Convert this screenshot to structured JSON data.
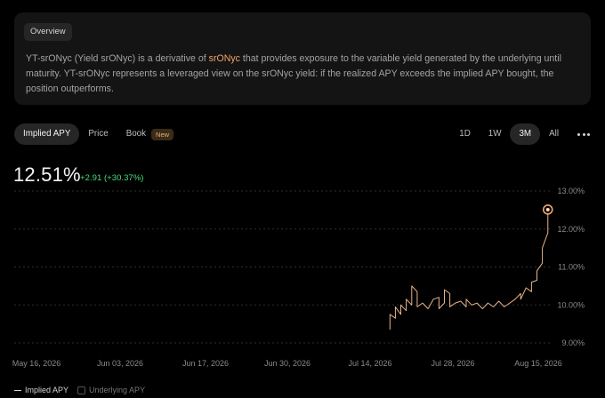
{
  "overview": {
    "tag": "Overview",
    "text_before": "YT-srONyc (Yield srONyc) is a derivative of ",
    "highlight": "srONyc",
    "text_after": " that provides exposure to the variable yield generated by the underlying until maturity. YT-srONyc represents a leveraged view on the srONyc yield: if the realized APY exceeds the implied APY bought, the position outperforms."
  },
  "tabs": [
    {
      "label": "Implied APY",
      "active": true
    },
    {
      "label": "Price",
      "active": false
    },
    {
      "label": "Book",
      "active": false,
      "badge": "New"
    }
  ],
  "ranges": [
    {
      "label": "1D",
      "active": false
    },
    {
      "label": "1W",
      "active": false
    },
    {
      "label": "3M",
      "active": true
    },
    {
      "label": "All",
      "active": false
    }
  ],
  "more_icon": "more-horizontal-icon",
  "summary": {
    "value": "12.51%",
    "change": "+2.91 (+30.37%)"
  },
  "colors": {
    "accent": "#f0a56a",
    "line": "#e8b48a",
    "positive": "#4ade80"
  },
  "chart_data": {
    "type": "line",
    "y_ticks": [
      "13.00%",
      "12.00%",
      "11.00%",
      "10.00%",
      "9.00%"
    ],
    "x_ticks": [
      "May 16, 2026",
      "Jun 03, 2026",
      "Jun 17, 2026",
      "Jun 30, 2026",
      "Jul 14, 2026",
      "Jul 28, 2026",
      "Aug 15, 2026"
    ],
    "ylim": [
      8.9,
      13.0
    ],
    "xlim": [
      "2026-05-16",
      "2026-08-24"
    ],
    "grid": true,
    "series": [
      {
        "name": "Implied APY",
        "points": [
          [
            "2026-07-24",
            9.35
          ],
          [
            "2026-07-24",
            9.75
          ],
          [
            "2026-07-25",
            9.65
          ],
          [
            "2026-07-25",
            9.95
          ],
          [
            "2026-07-26",
            9.75
          ],
          [
            "2026-07-26",
            10.0
          ],
          [
            "2026-07-27",
            9.85
          ],
          [
            "2026-07-27",
            10.15
          ],
          [
            "2026-07-28",
            10.0
          ],
          [
            "2026-07-28",
            10.5
          ],
          [
            "2026-07-29",
            10.35
          ],
          [
            "2026-07-29",
            9.95
          ],
          [
            "2026-07-30",
            10.05
          ],
          [
            "2026-07-31",
            9.9
          ],
          [
            "2026-08-01",
            10.15
          ],
          [
            "2026-08-02",
            10.2
          ],
          [
            "2026-08-02",
            9.9
          ],
          [
            "2026-08-03",
            10.05
          ],
          [
            "2026-08-03",
            10.4
          ],
          [
            "2026-08-04",
            10.3
          ],
          [
            "2026-08-04",
            9.95
          ],
          [
            "2026-08-05",
            10.05
          ],
          [
            "2026-08-06",
            10.1
          ],
          [
            "2026-08-07",
            9.95
          ],
          [
            "2026-08-07",
            10.15
          ],
          [
            "2026-08-08",
            10.0
          ],
          [
            "2026-08-09",
            10.05
          ],
          [
            "2026-08-10",
            9.9
          ],
          [
            "2026-08-11",
            10.05
          ],
          [
            "2026-08-12",
            9.95
          ],
          [
            "2026-08-13",
            10.1
          ],
          [
            "2026-08-14",
            9.95
          ],
          [
            "2026-08-15",
            10.05
          ],
          [
            "2026-08-16",
            10.15
          ],
          [
            "2026-08-17",
            10.3
          ],
          [
            "2026-08-17",
            10.15
          ],
          [
            "2026-08-18",
            10.45
          ],
          [
            "2026-08-19",
            10.35
          ],
          [
            "2026-08-19",
            10.6
          ],
          [
            "2026-08-20",
            10.65
          ],
          [
            "2026-08-20",
            10.9
          ],
          [
            "2026-08-21",
            11.1
          ],
          [
            "2026-08-21",
            11.5
          ],
          [
            "2026-08-22",
            11.9
          ],
          [
            "2026-08-22",
            12.51
          ]
        ]
      },
      {
        "name": "Underlying APY",
        "points": []
      }
    ]
  }
}
